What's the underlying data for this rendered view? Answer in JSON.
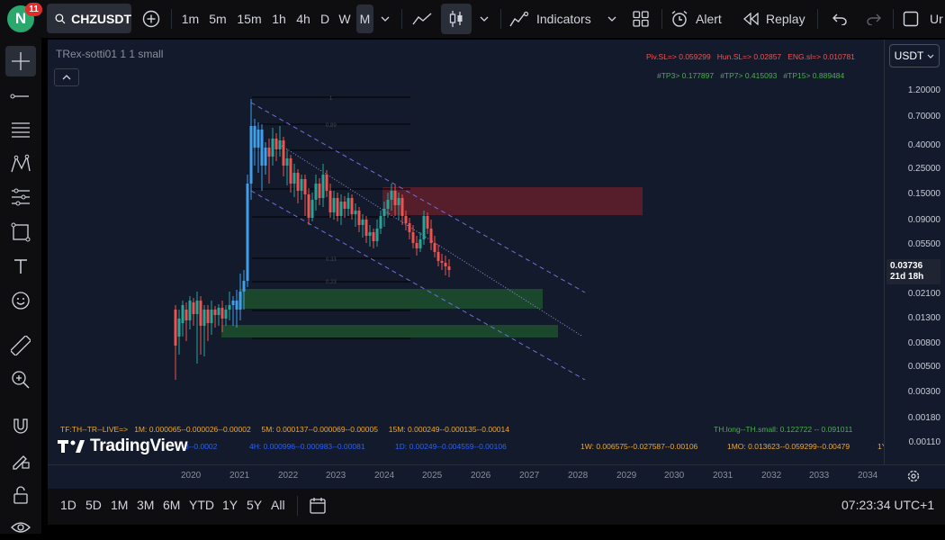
{
  "topbar": {
    "avatar_letter": "N",
    "notif_count": "11",
    "symbol": "CHZUSDT",
    "timeframes": [
      "1m",
      "5m",
      "15m",
      "1h",
      "4h",
      "D",
      "W",
      "M"
    ],
    "active_timeframe": "M",
    "indicators_label": "Indicators",
    "alert_label": "Alert",
    "replay_label": "Replay",
    "cut_label": "Ur"
  },
  "chart": {
    "indicator_title": "TRex-sotti01 1 1 small",
    "top_right_line1": [
      "Piv.SL=> 0.059299",
      "Hun.SL=> 0.02857",
      "ENG.sl=> 0.010781"
    ],
    "top_right_line2": [
      "#TP3> 0.177897",
      "#TP7> 0.415093",
      "#TP15> 0.889484"
    ],
    "fib_labels": [
      "1",
      "0.89",
      "0.33",
      "0.23"
    ],
    "bottom_info_row1": {
      "tf_prefix": "TF:TH--TR--LIVE=>",
      "m1": "1M: 0.000065--0.000026--0.00002",
      "m5": "5M: 0.000137--0.000069--0.00005",
      "m15": "15M: 0.000249--0.000135--0.00014",
      "th": "TH.long--TH.small: 0.122722 -- 0.091011"
    },
    "bottom_info_row2": {
      "left": "3--0.0002",
      "h4": "4H: 0.000996--0.000983--0.00081",
      "d1": "1D: 0.00249--0.004559--0.00106",
      "w1": "1W: 0.006575--0.027587--0.00106",
      "mo": "1MO: 0.013623--0.059299--0.00479",
      "tail": "1Y"
    },
    "brand": "TradingView",
    "colors": {
      "background": "#131a2b",
      "bull": "#26a69a",
      "bear": "#ef5350",
      "bull_candle_light": "#3f9fe8",
      "red_zone": "#6d1f2c",
      "green_zone": "#1d4d2d"
    }
  },
  "price_axis": {
    "currency": "USDT",
    "labels": [
      "1.20000",
      "0.70000",
      "0.40000",
      "0.25000",
      "0.15000",
      "0.09000",
      "0.05500",
      "0.02100",
      "0.01300",
      "0.00800",
      "0.00500",
      "0.00300",
      "0.00180",
      "0.00110"
    ],
    "current_price": "0.03736",
    "countdown": "21d 18h"
  },
  "time_axis": {
    "years": [
      "2020",
      "2021",
      "2022",
      "2023",
      "2024",
      "2025",
      "2026",
      "2027",
      "2028",
      "2029",
      "2030",
      "2031",
      "2032",
      "2033",
      "2034"
    ]
  },
  "bottombar": {
    "ranges": [
      "1D",
      "5D",
      "1M",
      "3M",
      "6M",
      "YTD",
      "1Y",
      "5Y",
      "All"
    ],
    "clock": "07:23:34 UTC+1"
  }
}
